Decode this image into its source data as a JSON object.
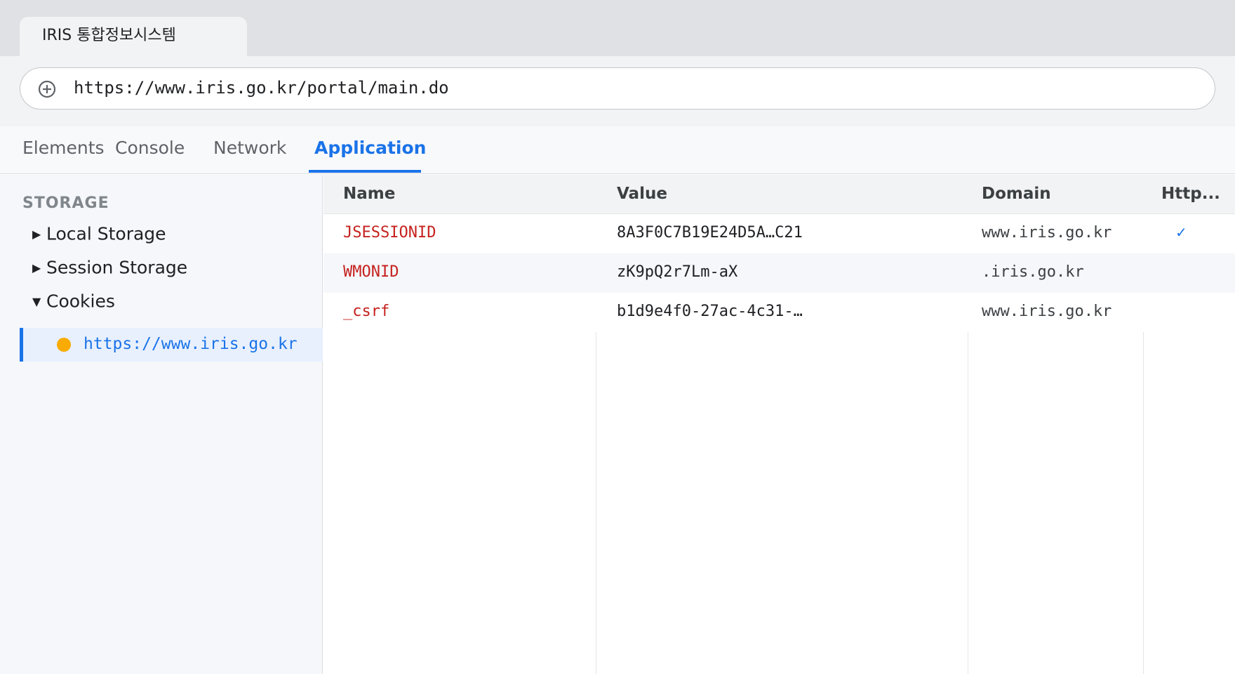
{
  "browser": {
    "tab_title": "IRIS 통합정보시스템",
    "url": "https://www.iris.go.kr/portal/main.do",
    "site_info_icon": "add-circle-icon"
  },
  "devtools": {
    "tabs": [
      "Elements",
      "Console",
      "Network",
      "Application"
    ],
    "active_tab": "Application",
    "accent_color": "#1a73e8"
  },
  "sidebar": {
    "heading": "STORAGE",
    "items": [
      {
        "label": "Local Storage",
        "arrow": "▶",
        "expanded": false
      },
      {
        "label": "Session Storage",
        "arrow": "▶",
        "expanded": false
      },
      {
        "label": "Cookies",
        "arrow": "▼",
        "expanded": true
      }
    ],
    "selected_origin": "https://www.iris.go.kr"
  },
  "cookies": {
    "columns": [
      "Name",
      "Value",
      "Domain",
      "Http..."
    ],
    "rows": [
      {
        "name": "JSESSIONID",
        "value": "8A3F0C7B19E24D5A…C21",
        "domain": "www.iris.go.kr",
        "http_only": "✓"
      },
      {
        "name": "WMONID",
        "value": "zK9pQ2r7Lm-aX",
        "domain": ".iris.go.kr",
        "http_only": ""
      },
      {
        "name": "_csrf",
        "value": "b1d9e4f0-27ac-4c31-…",
        "domain": "www.iris.go.kr",
        "http_only": ""
      }
    ]
  }
}
